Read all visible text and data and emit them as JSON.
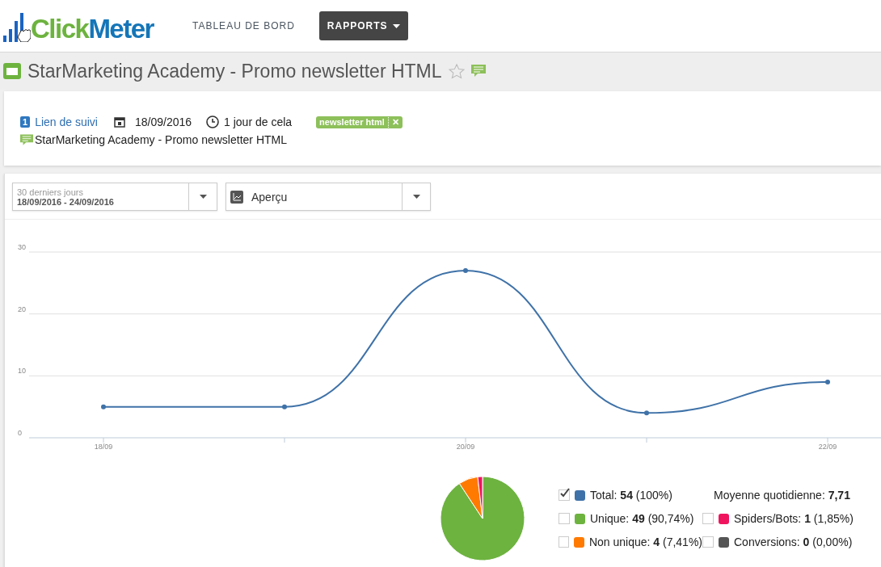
{
  "header": {
    "logo": {
      "part_1": "Click",
      "part_2": "Meter"
    },
    "nav": [
      {
        "label": "TABLEAU DE BORD",
        "selected": false,
        "dropdown": false
      },
      {
        "label": "RAPPORTS",
        "selected": true,
        "dropdown": true
      }
    ]
  },
  "title_bar": {
    "title": "StarMarketing Academy - Promo newsletter HTML",
    "starred": false
  },
  "info": {
    "link_count": "1",
    "link_label": "Lien de suivi",
    "date": "18/09/2016",
    "age": "1 jour de cela",
    "tags": [
      {
        "label": "newsletter html",
        "remove": "✕"
      }
    ],
    "note": "StarMarketing Academy - Promo newsletter HTML"
  },
  "filters": {
    "range": {
      "label": "30 derniers jours",
      "value": "18/09/2016 - 24/09/2016"
    },
    "view": {
      "value": "Aperçu"
    }
  },
  "line_chart": {
    "chart_data": {
      "type": "line",
      "categories": [
        "18/09",
        null,
        "20/09",
        null,
        "22/09"
      ],
      "series": [
        {
          "color": "#3f72a8",
          "marker": true,
          "values": [
            5,
            5,
            27,
            4,
            9
          ]
        }
      ],
      "ylim": [
        0,
        30
      ],
      "yticks": [
        0,
        10,
        20,
        30
      ]
    }
  },
  "summary": {
    "pie": {
      "chart_data": {
        "type": "pie",
        "values": [
          90.74,
          7.41,
          1.85
        ],
        "colors": [
          "#6db33f",
          "#ff7a00",
          "#f0145f"
        ]
      }
    },
    "legend": [
      {
        "kind": "series",
        "label": "Total:",
        "value": "54",
        "share": "(100%)",
        "color": "#3f72a8",
        "checked": true
      },
      {
        "kind": "average",
        "label": "Moyenne quotidienne:",
        "value": "7,71"
      },
      {
        "kind": "series",
        "label": "Unique:",
        "value": "49",
        "share": "(90,74%)",
        "color": "#6db33f",
        "checked": false
      },
      {
        "kind": "series",
        "label": "Spiders/Bots:",
        "value": "1",
        "share": "(1,85%)",
        "color": "#f0145f",
        "checked": false
      },
      {
        "kind": "series",
        "label": "Non unique:",
        "value": "4",
        "share": "(7,41%)",
        "color": "#ff7a00",
        "checked": false
      },
      {
        "kind": "series",
        "label": "Conversions:",
        "value": "0",
        "share": "(0,00%)",
        "color": "#555555",
        "checked": false
      }
    ]
  }
}
